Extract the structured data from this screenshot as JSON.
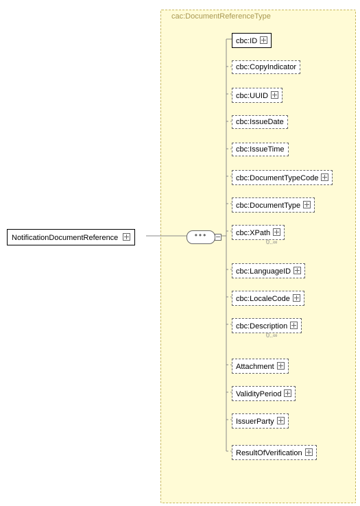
{
  "schema": {
    "root": "NotificationDocumentReference",
    "type_label": "cac:DocumentReferenceType",
    "children": [
      {
        "label": "cbc:ID",
        "required": true,
        "expand": true,
        "card": ""
      },
      {
        "label": "cbc:CopyIndicator",
        "required": false,
        "expand": false,
        "card": ""
      },
      {
        "label": "cbc:UUID",
        "required": false,
        "expand": true,
        "card": ""
      },
      {
        "label": "cbc:IssueDate",
        "required": false,
        "expand": false,
        "card": ""
      },
      {
        "label": "cbc:IssueTime",
        "required": false,
        "expand": false,
        "card": ""
      },
      {
        "label": "cbc:DocumentTypeCode",
        "required": false,
        "expand": true,
        "card": ""
      },
      {
        "label": "cbc:DocumentType",
        "required": false,
        "expand": true,
        "card": ""
      },
      {
        "label": "cbc:XPath",
        "required": false,
        "expand": true,
        "card": "0..∞"
      },
      {
        "label": "cbc:LanguageID",
        "required": false,
        "expand": true,
        "card": ""
      },
      {
        "label": "cbc:LocaleCode",
        "required": false,
        "expand": true,
        "card": ""
      },
      {
        "label": "cbc:Description",
        "required": false,
        "expand": true,
        "card": "0..∞"
      },
      {
        "label": "Attachment",
        "required": false,
        "expand": true,
        "card": ""
      },
      {
        "label": "ValidityPeriod",
        "required": false,
        "expand": true,
        "card": ""
      },
      {
        "label": "IssuerParty",
        "required": false,
        "expand": true,
        "card": ""
      },
      {
        "label": "ResultOfVerification",
        "required": false,
        "expand": true,
        "card": ""
      }
    ]
  }
}
